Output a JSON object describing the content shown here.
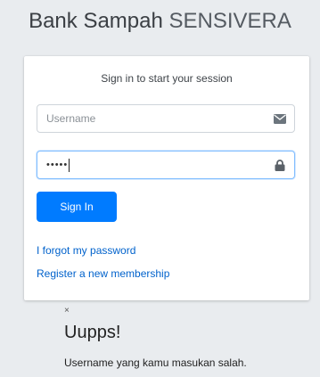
{
  "brand": {
    "bold": "Bank Sampah",
    "light": "SENSIVERA"
  },
  "login": {
    "message": "Sign in to start your session",
    "username_placeholder": "Username",
    "password_masked": "•••••",
    "signin_label": "Sign In",
    "forgot_label": "I forgot my password",
    "register_label": "Register a new membership"
  },
  "alert": {
    "close_label": "×",
    "title": "Uupps!",
    "message": "Username yang kamu masukan salah."
  },
  "colors": {
    "primary": "#007bff",
    "background": "#e9ecef",
    "link": "#0062cc"
  },
  "icons": {
    "username": "envelope-icon",
    "password": "lock-icon"
  }
}
